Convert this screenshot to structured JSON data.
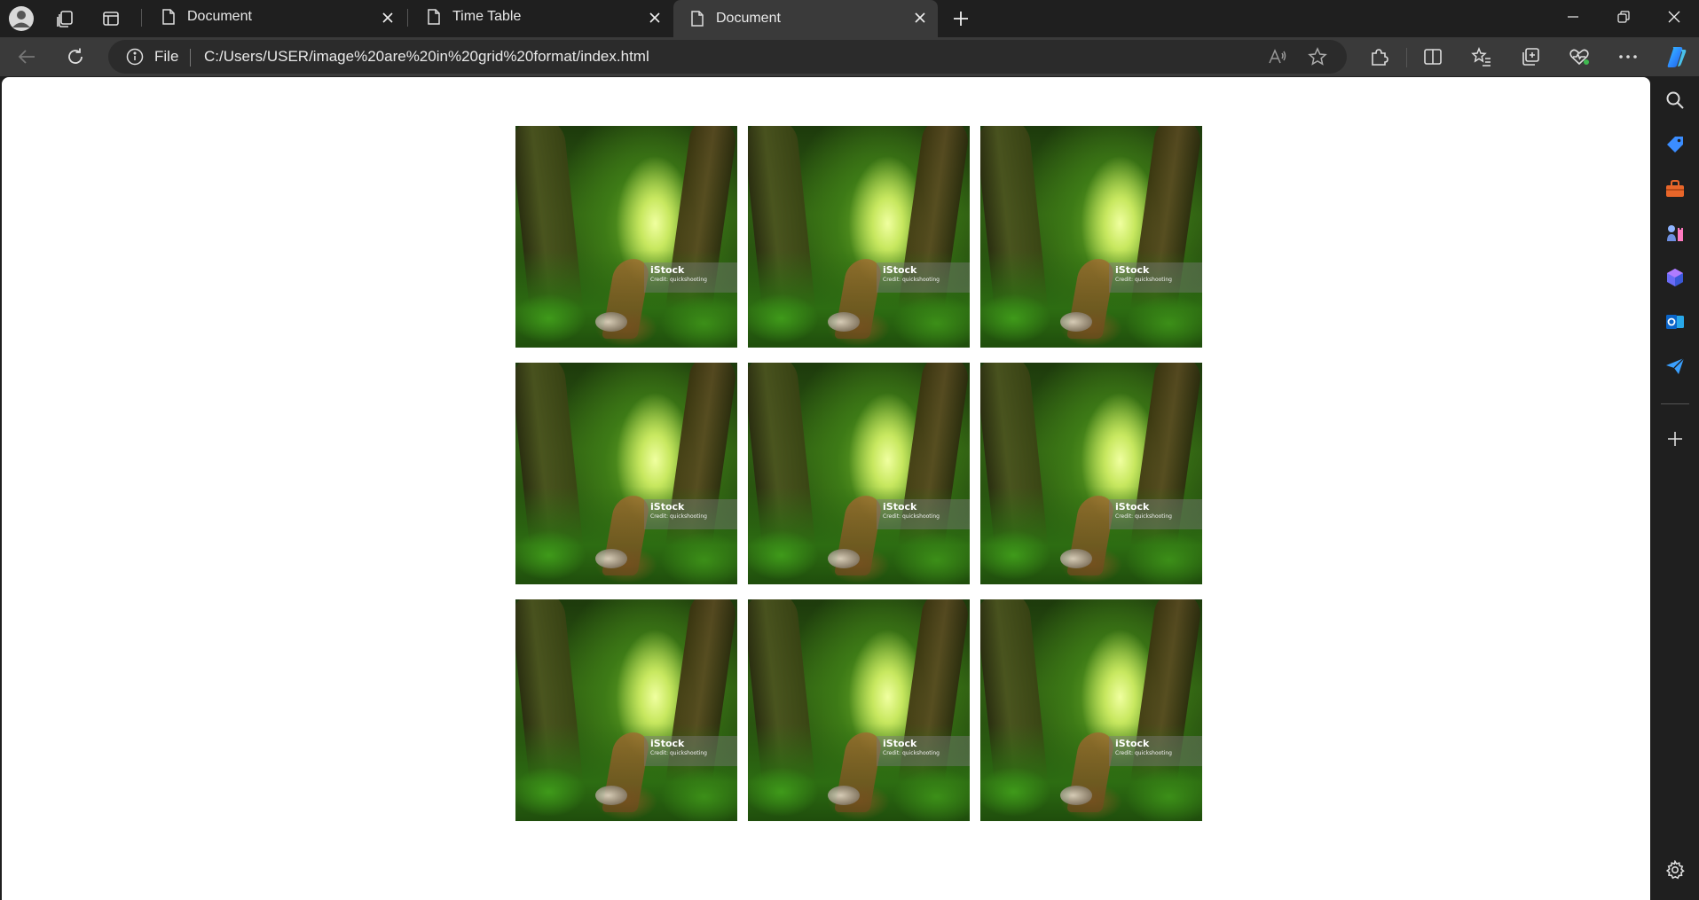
{
  "tabs": [
    {
      "label": "Document",
      "active": false
    },
    {
      "label": "Time Table",
      "active": false
    },
    {
      "label": "Document",
      "active": true
    }
  ],
  "address_bar": {
    "scheme": "File",
    "url": "C:/Users/USER/image%20are%20in%20grid%20format/index.html"
  },
  "page": {
    "images": [
      {
        "watermark": "iStock",
        "credit": "Credit: quickshooting"
      },
      {
        "watermark": "iStock",
        "credit": "Credit: quickshooting"
      },
      {
        "watermark": "iStock",
        "credit": "Credit: quickshooting"
      },
      {
        "watermark": "iStock",
        "credit": "Credit: quickshooting"
      },
      {
        "watermark": "iStock",
        "credit": "Credit: quickshooting"
      },
      {
        "watermark": "iStock",
        "credit": "Credit: quickshooting"
      },
      {
        "watermark": "iStock",
        "credit": "Credit: quickshooting"
      },
      {
        "watermark": "iStock",
        "credit": "Credit: quickshooting"
      },
      {
        "watermark": "iStock",
        "credit": "Credit: quickshooting"
      }
    ]
  },
  "icons": {
    "profile": "profile-icon",
    "workspaces": "workspaces-icon",
    "tab_actions": "tab-actions-icon",
    "new_tab": "plus-icon",
    "back": "back-arrow-icon",
    "refresh": "refresh-icon",
    "read_aloud": "read-aloud-icon",
    "favorite": "star-icon",
    "extensions": "puzzle-icon",
    "split_screen": "split-screen-icon",
    "favorites": "favorites-icon",
    "collections": "collections-icon",
    "browser_essentials": "heart-pulse-icon",
    "more": "more-icon",
    "copilot": "copilot-icon"
  },
  "colors": {
    "chrome_dark": "#1f1f1f",
    "toolbar": "#3a3a3a",
    "page_bg": "#ffffff",
    "copilot_blue": "#2d8cff"
  }
}
